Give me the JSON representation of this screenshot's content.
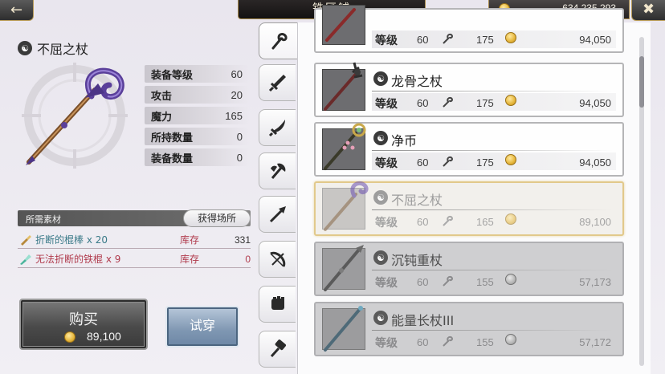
{
  "header": {
    "back_icon": "back-arrow-icon",
    "title": "铁匠铺",
    "gold": "634,235,293",
    "close_icon": "close-icon"
  },
  "selected_item": {
    "name": "不屈之杖",
    "stats": [
      {
        "label": "装备等级",
        "value": "60"
      },
      {
        "label": "攻击",
        "value": "20"
      },
      {
        "label": "魔力",
        "value": "165"
      },
      {
        "label": "所持数量",
        "value": "0"
      },
      {
        "label": "装备数量",
        "value": "0"
      }
    ]
  },
  "materials": {
    "header": "所需素材",
    "source_button": "获得场所",
    "items": [
      {
        "name": "折断的棍棒 x 20",
        "stock_label": "库存",
        "stock": "331"
      },
      {
        "name": "无法折断的铁棍 x 9",
        "stock_label": "库存",
        "stock": "0"
      }
    ]
  },
  "actions": {
    "buy_label": "购买",
    "buy_price": "89,100",
    "try_label": "试穿"
  },
  "tabs": [
    "wand-icon",
    "sword-icon",
    "saber-icon",
    "axe-icon",
    "spear-icon",
    "bow-icon",
    "gauntlet-icon",
    "hammer-icon"
  ],
  "list": {
    "level_label": "等级",
    "items": [
      {
        "name": "",
        "level": "60",
        "power": "175",
        "price": "94,050",
        "state": "normal"
      },
      {
        "name": "龙骨之杖",
        "level": "60",
        "power": "175",
        "price": "94,050",
        "state": "normal"
      },
      {
        "name": "净币",
        "level": "60",
        "power": "175",
        "price": "94,050",
        "state": "normal"
      },
      {
        "name": "不屈之杖",
        "level": "60",
        "power": "165",
        "price": "89,100",
        "state": "selected"
      },
      {
        "name": "沉钝重杖",
        "level": "60",
        "power": "155",
        "price": "57,173",
        "state": "locked"
      },
      {
        "name": "能量长杖III",
        "level": "60",
        "power": "155",
        "price": "57,172",
        "state": "locked"
      }
    ]
  },
  "colors": {
    "gold_trim": "#a88b4d",
    "material_red": "#b03a4c",
    "material_teal": "#3a7a88",
    "selected_border": "#e2c98b",
    "try_blue": "#7f97b2"
  }
}
